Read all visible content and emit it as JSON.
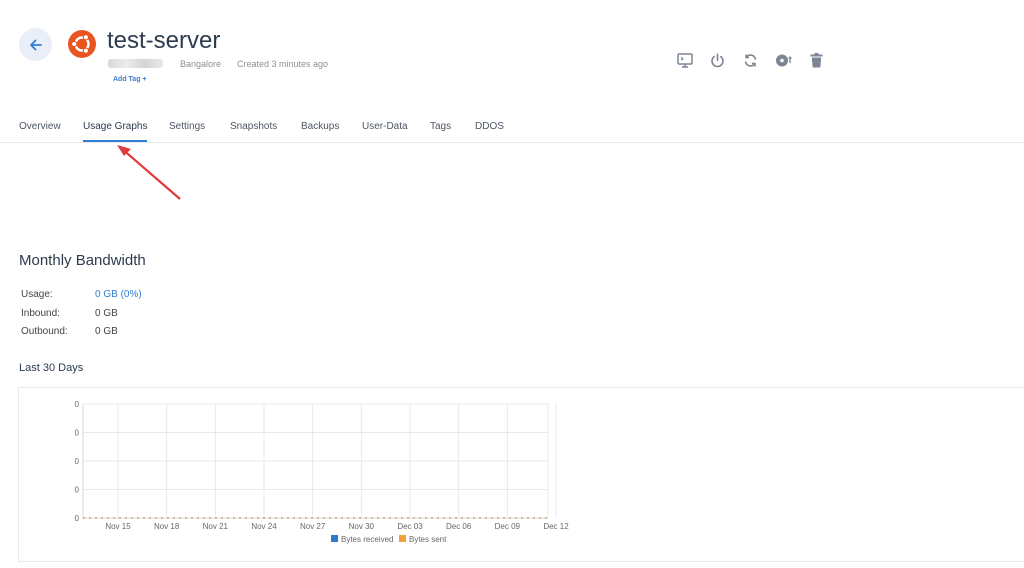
{
  "header": {
    "server_name": "test-server",
    "location": "Bangalore",
    "created": "Created 3 minutes ago",
    "add_tag": "Add Tag +",
    "back_icon": "arrow-left-icon",
    "os_logo": "ubuntu-logo",
    "actions": [
      {
        "name": "console-button",
        "icon": "monitor-icon"
      },
      {
        "name": "power-button",
        "icon": "power-icon"
      },
      {
        "name": "reboot-button",
        "icon": "refresh-icon"
      },
      {
        "name": "reinstall-button",
        "icon": "disc-icon"
      },
      {
        "name": "delete-button",
        "icon": "trash-icon"
      }
    ]
  },
  "tabs": [
    {
      "label": "Overview"
    },
    {
      "label": "Usage Graphs",
      "active": true
    },
    {
      "label": "Settings"
    },
    {
      "label": "Snapshots"
    },
    {
      "label": "Backups"
    },
    {
      "label": "User-Data"
    },
    {
      "label": "Tags"
    },
    {
      "label": "DDOS"
    }
  ],
  "bandwidth": {
    "title": "Monthly Bandwidth",
    "rows": [
      {
        "label": "Usage:",
        "value": "0 GB (0%)"
      },
      {
        "label": "Inbound:",
        "value": "0 GB"
      },
      {
        "label": "Outbound:",
        "value": "0 GB"
      }
    ]
  },
  "last30": {
    "title": "Last 30 Days"
  },
  "colors": {
    "accent": "#2f7fd6",
    "bytes_received": "#2b7bd3",
    "bytes_sent": "#f0a23c",
    "arrow": "#e0393e"
  },
  "chart_data": {
    "type": "line",
    "categories": [
      "Nov 15",
      "Nov 18",
      "Nov 21",
      "Nov 24",
      "Nov 27",
      "Nov 30",
      "Dec 03",
      "Dec 06",
      "Dec 09",
      "Dec 12"
    ],
    "y_ticks": [
      "0",
      "0",
      "0",
      "0",
      "0"
    ],
    "series": [
      {
        "name": "Bytes received",
        "values": [
          0,
          0,
          0,
          0,
          0,
          0,
          0,
          0,
          0,
          0
        ]
      },
      {
        "name": "Bytes sent",
        "values": [
          0,
          0,
          0,
          0,
          0,
          0,
          0,
          0,
          0,
          0
        ]
      }
    ],
    "ylim": [
      0,
      0
    ],
    "grid": true,
    "legend": "bottom"
  }
}
